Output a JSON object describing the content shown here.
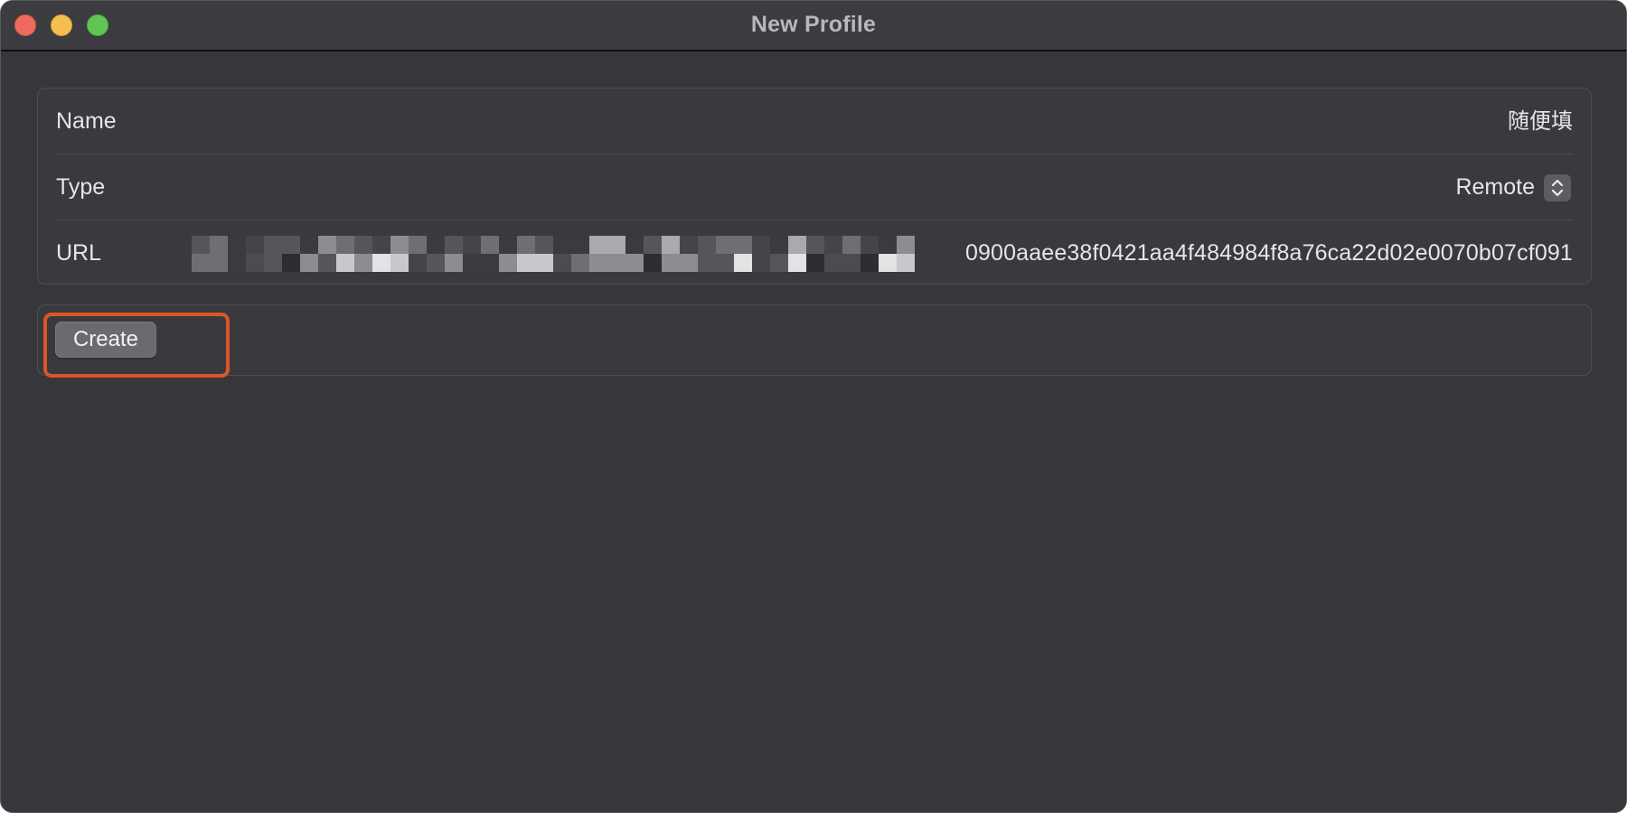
{
  "window": {
    "title": "New Profile"
  },
  "form": {
    "name": {
      "label": "Name",
      "value": "随便填"
    },
    "type": {
      "label": "Type",
      "selected": "Remote"
    },
    "url": {
      "label": "URL",
      "visible_value": "0900aaee38f0421aa4f484984f8a76ca22d02e0070b07cf091",
      "obscured": true
    }
  },
  "actions": {
    "create_label": "Create"
  },
  "colors": {
    "window_background": "#36363b",
    "titlebar": "#3b3b40",
    "group_background": "#39393e",
    "text": "#e6e6e8",
    "button": "#6a6a6f",
    "highlight": "#d9562a",
    "traffic_close": "#ec6a5e",
    "traffic_minimize": "#f4bf4f",
    "traffic_maximize": "#61c554"
  },
  "icons": {
    "type_popup": "chevron-up-down-icon"
  }
}
